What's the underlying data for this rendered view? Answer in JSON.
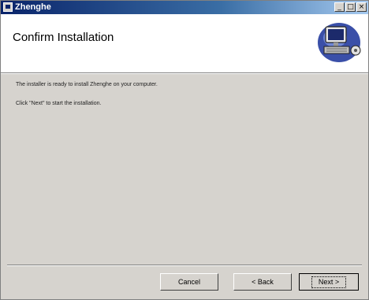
{
  "window": {
    "title": "Zhenghe"
  },
  "title_buttons": {
    "minimize": "_",
    "maximize": "□",
    "close": "×"
  },
  "header": {
    "title": "Confirm Installation",
    "logo_icon": "computer-install-icon"
  },
  "content": {
    "line1": "The installer is ready to install Zhenghe on your computer.",
    "line2": "Click \"Next\" to start the installation."
  },
  "buttons": {
    "cancel": "Cancel",
    "back": "< Back",
    "next": "Next >"
  },
  "colors": {
    "titlebar_start": "#0a246a",
    "titlebar_end": "#a6caf0",
    "face": "#d6d3ce"
  }
}
